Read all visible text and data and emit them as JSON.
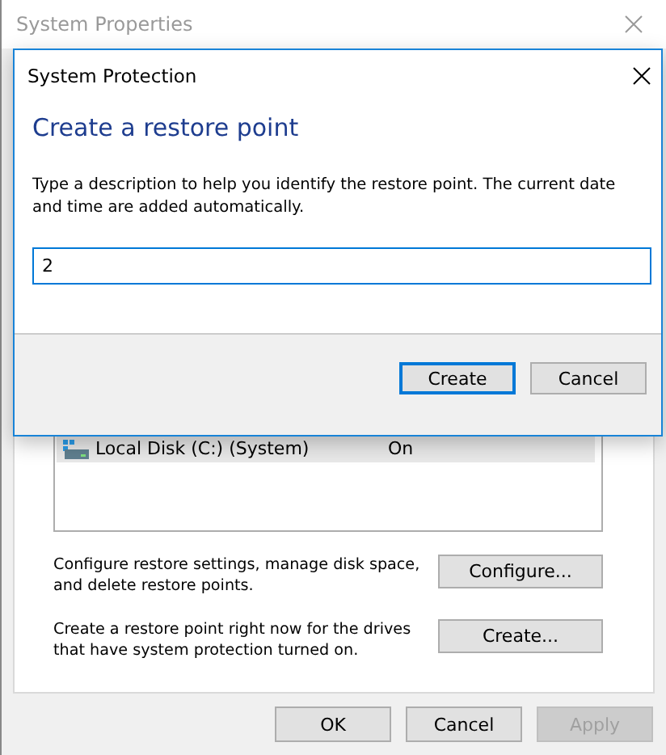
{
  "system_properties": {
    "title": "System Properties",
    "drives": [
      {
        "name": "Local Disk (C:) (System)",
        "protection": "On",
        "selected": true
      }
    ],
    "actions": [
      {
        "text": "Configure restore settings, manage disk space, and delete restore points.",
        "button": "Configure..."
      },
      {
        "text": "Create a restore point right now for the drives that have system protection turned on.",
        "button": "Create..."
      }
    ],
    "buttons": [
      {
        "label": "OK",
        "disabled": false
      },
      {
        "label": "Cancel",
        "disabled": false
      },
      {
        "label": "Apply",
        "disabled": true
      }
    ]
  },
  "dialog": {
    "title": "System Protection",
    "heading": "Create a restore point",
    "description": "Type a description to help you identify the restore point. The current date and time are added automatically.",
    "input_value": "2",
    "buttons": [
      {
        "label": "Create",
        "default": true
      },
      {
        "label": "Cancel",
        "default": false
      }
    ]
  }
}
